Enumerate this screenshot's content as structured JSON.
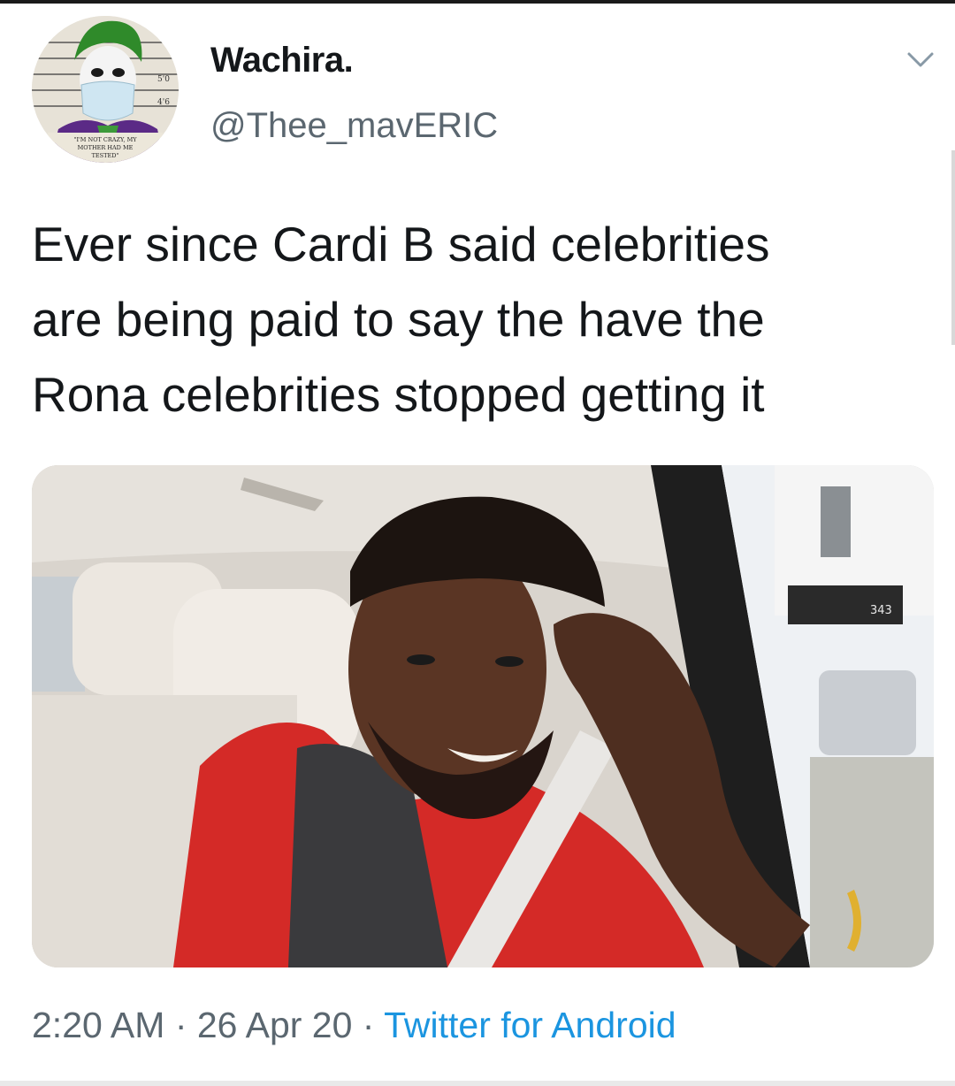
{
  "tweet": {
    "author": {
      "display_name": "Wachira.",
      "handle": "@Thee_mavERIC",
      "avatar_caption": "\"I'M NOT CRAZY, MY MOTHER HAD ME TESTED\""
    },
    "text_lines": [
      "Ever since Cardi B said celebrities",
      "are being paid to say the have the",
      "Rona celebrities stopped getting it"
    ],
    "timestamp": {
      "time": "2:20 AM",
      "separator": " · ",
      "date": "26 Apr 20",
      "source": "Twitter for Android"
    },
    "menu_icon": "chevron-down-icon",
    "media": {
      "description": "photo",
      "sign_text": "343"
    }
  },
  "colors": {
    "text_primary": "#14171a",
    "text_secondary": "#5b6770",
    "link": "#1b95e0",
    "background": "#ffffff"
  }
}
